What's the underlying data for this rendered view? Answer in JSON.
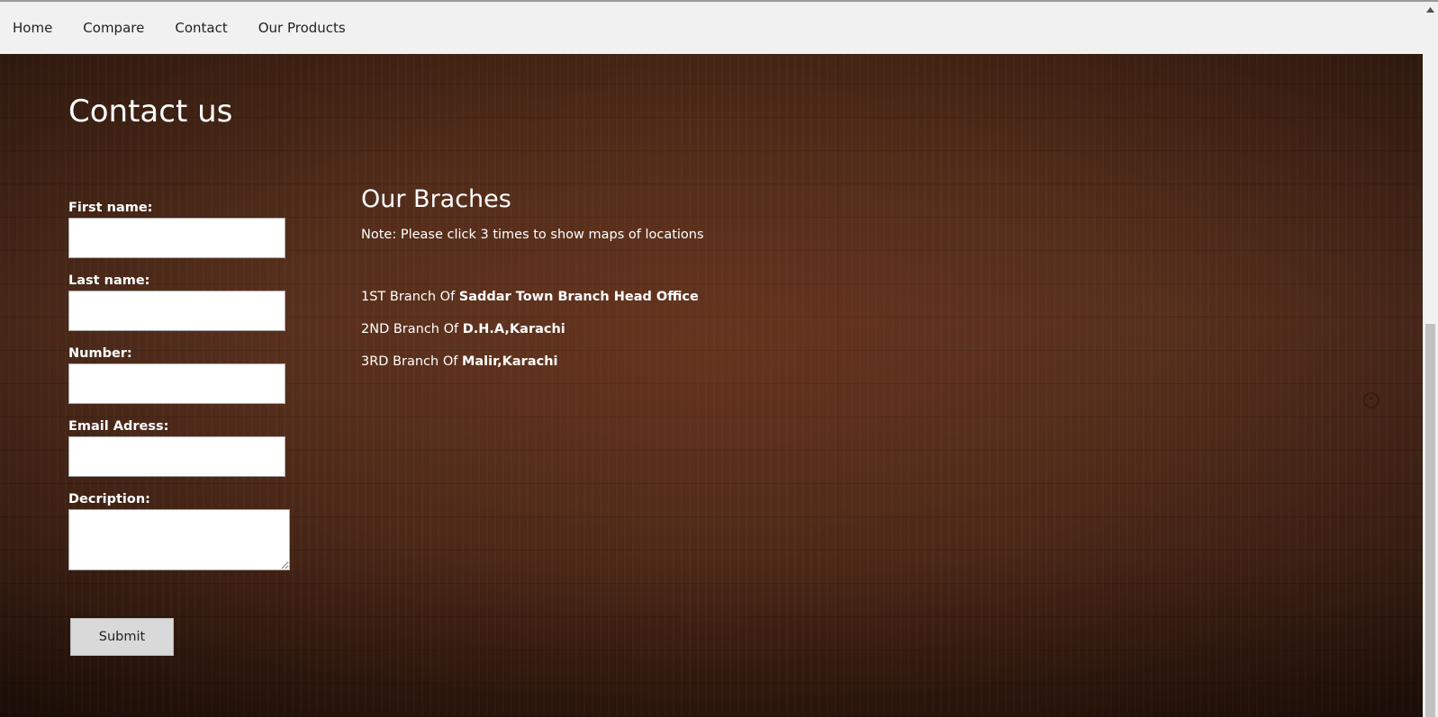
{
  "nav": {
    "items": [
      "Home",
      "Compare",
      "Contact",
      "Our Products"
    ]
  },
  "contact": {
    "title": "Contact us",
    "fields": {
      "first_name_label": "First name:",
      "last_name_label": "Last name:",
      "number_label": "Number:",
      "email_label": "Email Adress:",
      "description_label": "Decription:"
    },
    "submit_label": "Submit"
  },
  "branches": {
    "title": "Our Braches",
    "note": "Note: Please click 3 times to show maps of locations",
    "items": [
      {
        "prefix": "1ST Branch Of ",
        "name": "Saddar Town Branch Head Office"
      },
      {
        "prefix": "2ND Branch Of ",
        "name": "D.H.A,Karachi"
      },
      {
        "prefix": "3RD Branch Of ",
        "name": "Malir,Karachi"
      }
    ]
  },
  "icons": {
    "refresh": "refresh-icon",
    "scroll_up": "chevron-up-icon"
  },
  "colors": {
    "nav_bg": "#f1f1f1",
    "page_bg": "#4a2817",
    "text": "#ffffff",
    "button_bg": "#d9d9d9"
  }
}
